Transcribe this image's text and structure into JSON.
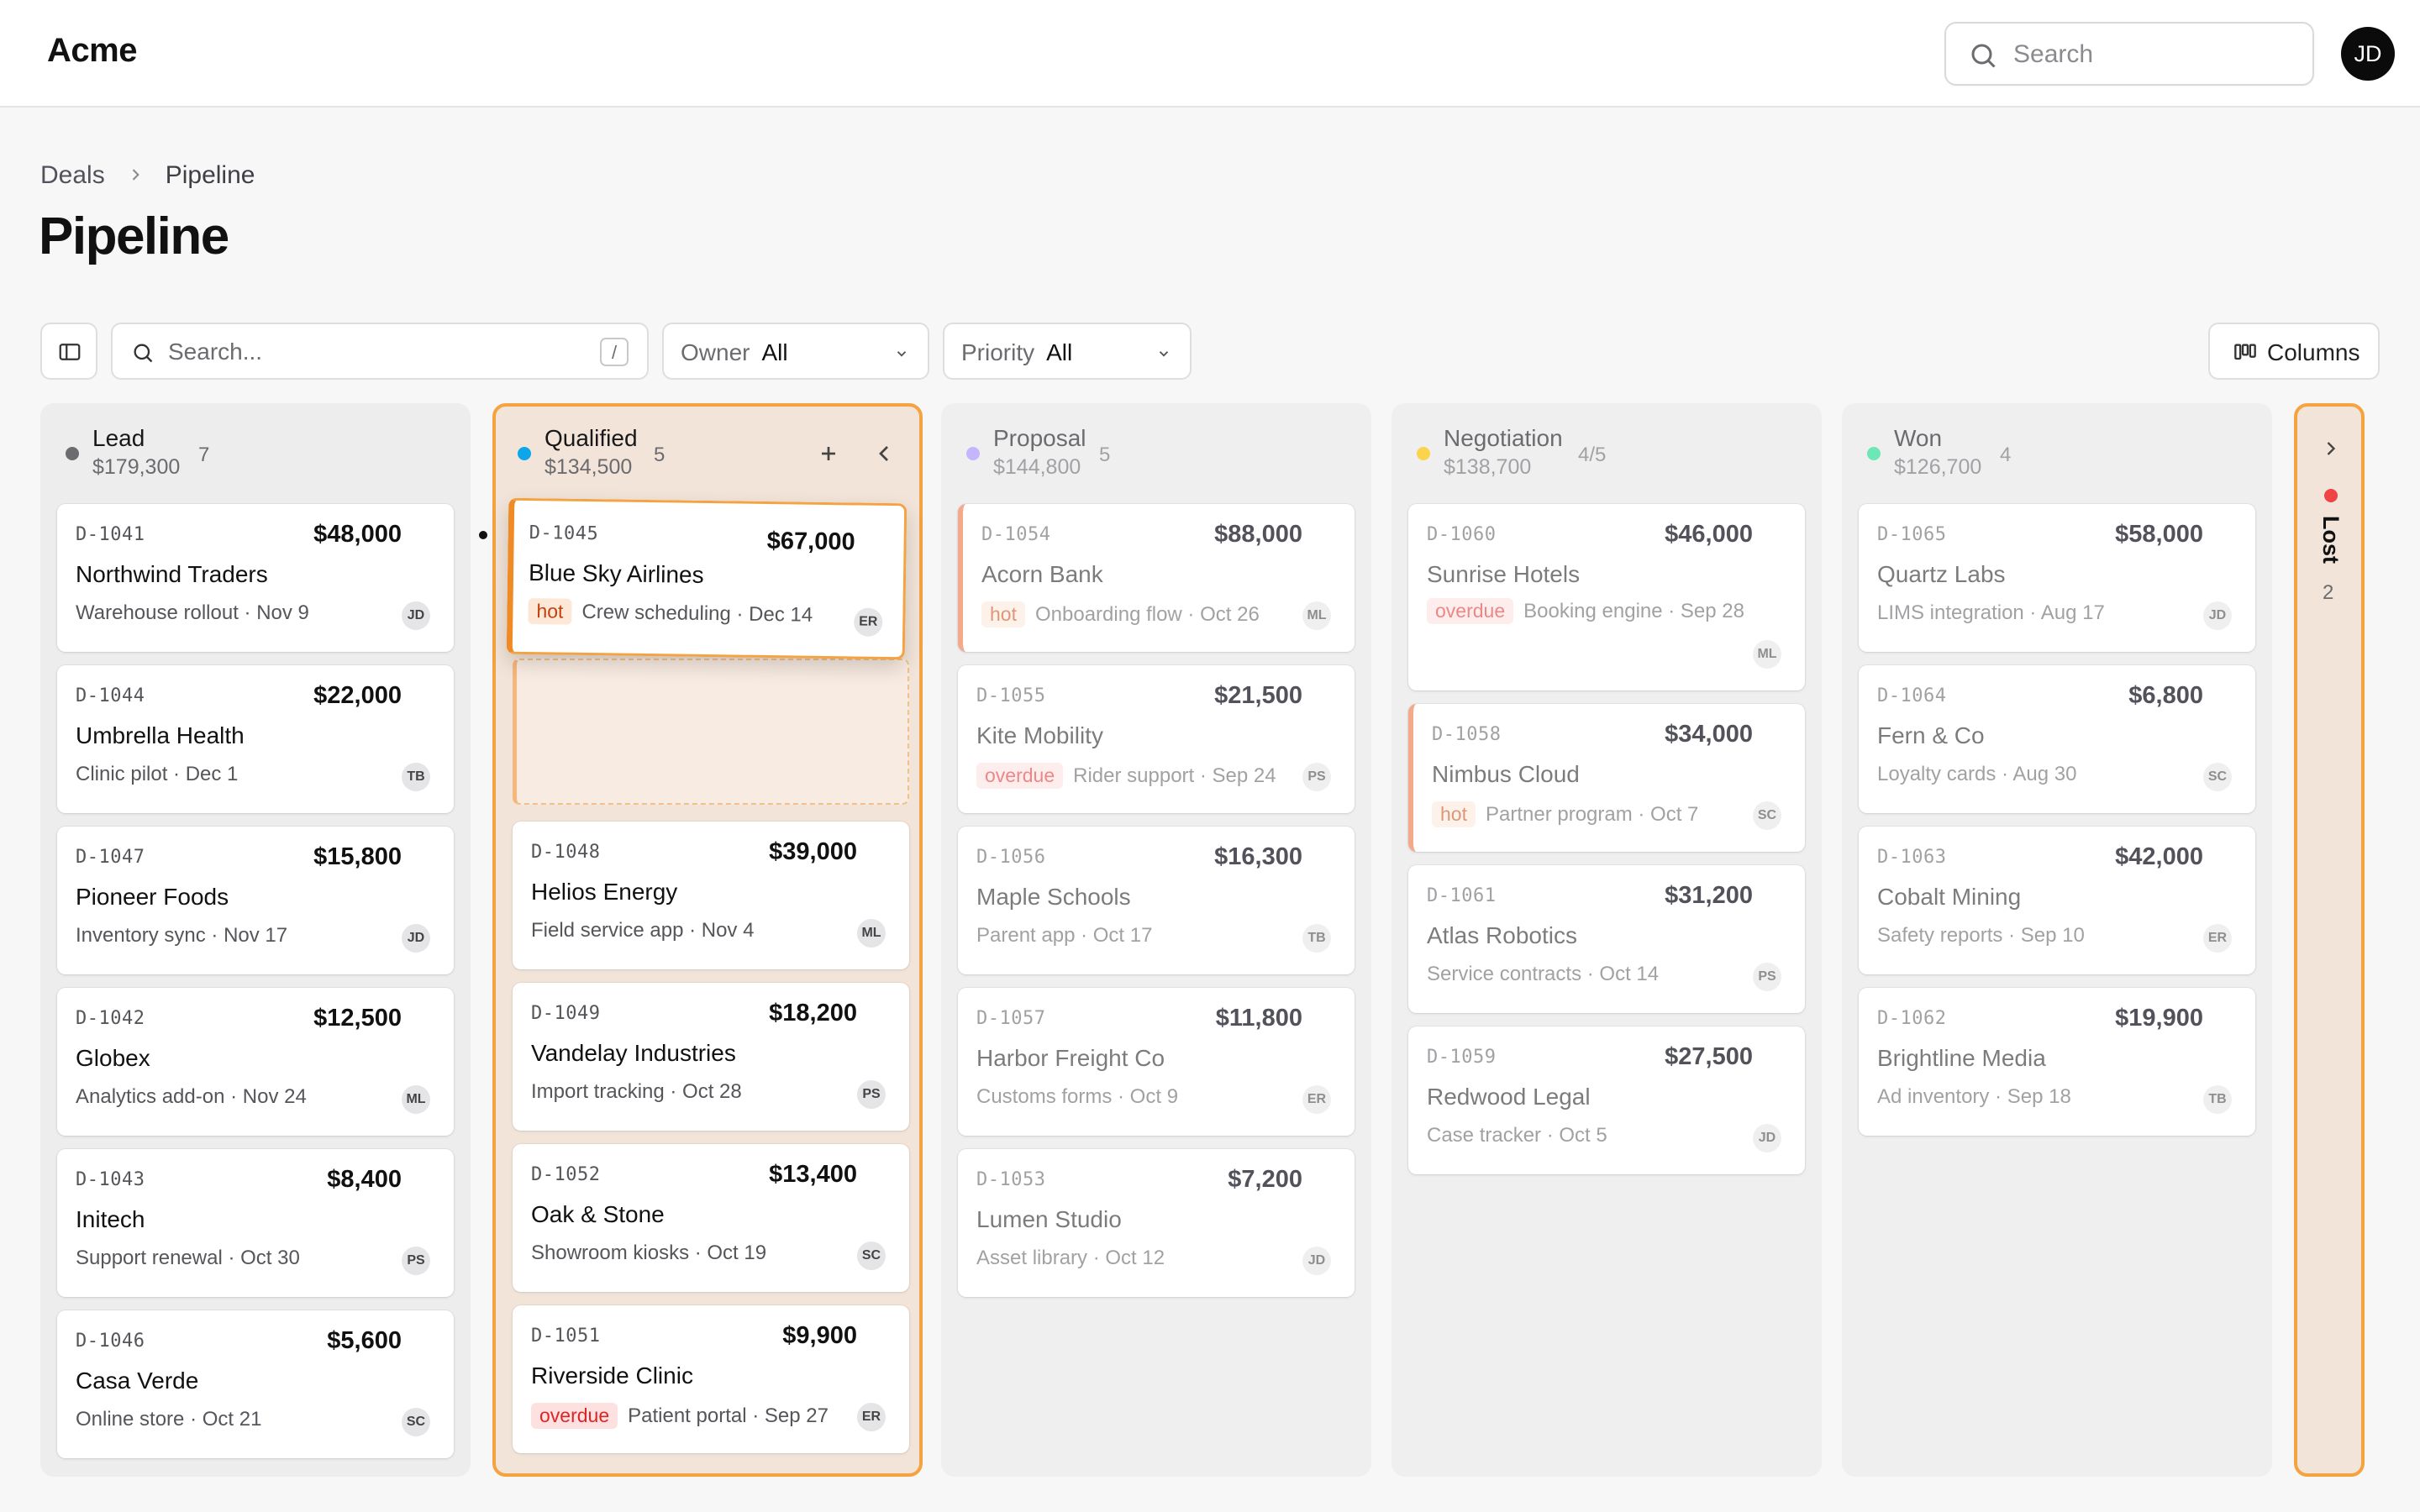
{
  "app": {
    "brand": "Acme",
    "search_placeholder": "Search",
    "user_initials": "JD"
  },
  "breadcrumb": {
    "parent": "Deals",
    "current": "Pipeline"
  },
  "page": {
    "title": "Pipeline"
  },
  "toolbar": {
    "search_placeholder": "Search...",
    "search_shortcut": "/",
    "owner_label": "Owner",
    "owner_value": "All",
    "priority_label": "Priority",
    "priority_value": "All",
    "columns_label": "Columns"
  },
  "colors": {
    "accent": "#f5a340",
    "lead": "#6b6b70",
    "qualified": "#0ea5e9",
    "proposal": "#c4b5fd",
    "negotiation": "#fcd34d",
    "won": "#6ee7b7",
    "lost": "#ef4444"
  },
  "columns": {
    "lead": {
      "name": "Lead",
      "total": "$179,300",
      "count": "7",
      "cards": [
        {
          "id": "D-1041",
          "amount": "$48,000",
          "name": "Northwind Traders",
          "sub": "Warehouse rollout · Nov 9",
          "owner": "JD"
        },
        {
          "id": "D-1044",
          "amount": "$22,000",
          "name": "Umbrella Health",
          "sub": "Clinic pilot · Dec 1",
          "owner": "TB"
        },
        {
          "id": "D-1047",
          "amount": "$15,800",
          "name": "Pioneer Foods",
          "sub": "Inventory sync · Nov 17",
          "owner": "JD"
        },
        {
          "id": "D-1042",
          "amount": "$12,500",
          "name": "Globex",
          "sub": "Analytics add-on · Nov 24",
          "owner": "ML"
        },
        {
          "id": "D-1043",
          "amount": "$8,400",
          "name": "Initech",
          "sub": "Support renewal · Oct 30",
          "owner": "PS"
        },
        {
          "id": "D-1046",
          "amount": "$5,600",
          "name": "Casa Verde",
          "sub": "Online store · Oct 21",
          "owner": "SC"
        }
      ]
    },
    "qualified": {
      "name": "Qualified",
      "total": "$134,500",
      "count": "5",
      "dragging": {
        "id": "D-1045",
        "amount": "$67,000",
        "name": "Blue Sky Airlines",
        "tag": "hot",
        "sub": "Crew scheduling · Dec 14",
        "owner": "ER"
      },
      "cards": [
        {
          "id": "D-1048",
          "amount": "$39,000",
          "name": "Helios Energy",
          "sub": "Field service app · Nov 4",
          "owner": "ML"
        },
        {
          "id": "D-1049",
          "amount": "$18,200",
          "name": "Vandelay Industries",
          "sub": "Import tracking · Oct 28",
          "owner": "PS"
        },
        {
          "id": "D-1052",
          "amount": "$13,400",
          "name": "Oak & Stone",
          "sub": "Showroom kiosks · Oct 19",
          "owner": "SC"
        },
        {
          "id": "D-1051",
          "amount": "$9,900",
          "name": "Riverside Clinic",
          "tag": "overdue",
          "sub": "Patient portal · Sep 27",
          "owner": "ER"
        }
      ]
    },
    "proposal": {
      "name": "Proposal",
      "total": "$144,800",
      "count": "5",
      "cards": [
        {
          "id": "D-1054",
          "amount": "$88,000",
          "name": "Acorn Bank",
          "tag": "hot",
          "sub": "Onboarding flow · Oct 26",
          "owner": "ML"
        },
        {
          "id": "D-1055",
          "amount": "$21,500",
          "name": "Kite Mobility",
          "tag": "overdue",
          "sub": "Rider support · Sep 24",
          "owner": "PS"
        },
        {
          "id": "D-1056",
          "amount": "$16,300",
          "name": "Maple Schools",
          "sub": "Parent app · Oct 17",
          "owner": "TB"
        },
        {
          "id": "D-1057",
          "amount": "$11,800",
          "name": "Harbor Freight Co",
          "sub": "Customs forms · Oct 9",
          "owner": "ER"
        },
        {
          "id": "D-1053",
          "amount": "$7,200",
          "name": "Lumen Studio",
          "sub": "Asset library · Oct 12",
          "owner": "JD"
        }
      ]
    },
    "negotiation": {
      "name": "Negotiation",
      "total": "$138,700",
      "count": "4/5",
      "cards": [
        {
          "id": "D-1060",
          "amount": "$46,000",
          "name": "Sunrise Hotels",
          "tag": "overdue",
          "sub": "Booking engine · Sep 28",
          "owner": "ML"
        },
        {
          "id": "D-1058",
          "amount": "$34,000",
          "name": "Nimbus Cloud",
          "tag": "hot",
          "sub": "Partner program · Oct 7",
          "owner": "SC"
        },
        {
          "id": "D-1061",
          "amount": "$31,200",
          "name": "Atlas Robotics",
          "sub": "Service contracts · Oct 14",
          "owner": "PS"
        },
        {
          "id": "D-1059",
          "amount": "$27,500",
          "name": "Redwood Legal",
          "sub": "Case tracker · Oct 5",
          "owner": "JD"
        }
      ]
    },
    "won": {
      "name": "Won",
      "total": "$126,700",
      "count": "4",
      "cards": [
        {
          "id": "D-1065",
          "amount": "$58,000",
          "name": "Quartz Labs",
          "sub": "LIMS integration · Aug 17",
          "owner": "JD"
        },
        {
          "id": "D-1064",
          "amount": "$6,800",
          "name": "Fern & Co",
          "sub": "Loyalty cards · Aug 30",
          "owner": "SC"
        },
        {
          "id": "D-1063",
          "amount": "$42,000",
          "name": "Cobalt Mining",
          "sub": "Safety reports · Sep 10",
          "owner": "ER"
        },
        {
          "id": "D-1062",
          "amount": "$19,900",
          "name": "Brightline Media",
          "sub": "Ad inventory · Sep 18",
          "owner": "TB"
        }
      ]
    },
    "lost": {
      "name": "Lost",
      "count": "2"
    }
  }
}
